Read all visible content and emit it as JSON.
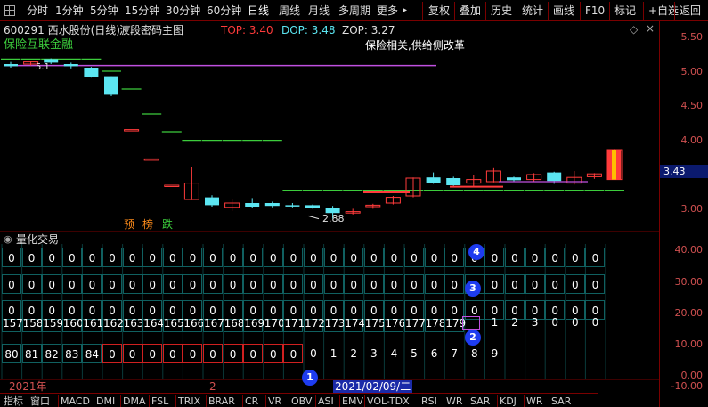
{
  "toolbar": {
    "items": [
      {
        "label": "分时",
        "name": "tab-minute"
      },
      {
        "label": "1分钟",
        "name": "tab-1min"
      },
      {
        "label": "5分钟",
        "name": "tab-5min"
      },
      {
        "label": "15分钟",
        "name": "tab-15min"
      },
      {
        "label": "30分钟",
        "name": "tab-30min"
      },
      {
        "label": "60分钟",
        "name": "tab-60min"
      },
      {
        "label": "日线",
        "name": "tab-daily"
      },
      {
        "label": "周线",
        "name": "tab-weekly"
      },
      {
        "label": "月线",
        "name": "tab-monthly"
      },
      {
        "label": "多周期",
        "name": "tab-multi-period"
      },
      {
        "label": "更多",
        "name": "more-dropdown"
      }
    ],
    "more_arrow": "▸",
    "right_items": [
      {
        "label": "复权",
        "name": "adjust-button"
      },
      {
        "label": "叠加",
        "name": "overlay-button"
      },
      {
        "label": "历史",
        "name": "history-button"
      },
      {
        "label": "统计",
        "name": "stats-button"
      },
      {
        "label": "画线",
        "name": "draw-line-button"
      },
      {
        "label": "F10",
        "name": "f10-button"
      },
      {
        "label": "标记",
        "name": "mark-button"
      },
      {
        "label": "+自选",
        "name": "add-watchlist-button"
      },
      {
        "label": "返回",
        "name": "back-button"
      }
    ]
  },
  "header": {
    "stock": "600291 西水股份(日线)",
    "indicator": "波段密码主图",
    "top_label": "TOP: 3.40",
    "dop_label": "DOP: 3.48",
    "zop_label": "ZOP: 3.27"
  },
  "overlays": {
    "sector": "保险互联金融",
    "note": "保险相关,供给侧改革",
    "price_low": "2.88",
    "tags": [
      "预",
      "榜",
      "跌"
    ],
    "current_price": "3.43",
    "small_label": "5.1"
  },
  "colors": {
    "up": "#ff3b3b",
    "down": "#5ce6f2",
    "green_line": "#3ccc3c",
    "purple_line": "#c050e0",
    "axis_text": "#d05050",
    "grid_border": "#106060",
    "red_border": "#d02020",
    "badge": "#1e3cf0",
    "toolbar_border": "#7a0000"
  },
  "sub_panel": {
    "title": "量化交易",
    "rows": [
      [
        "0",
        "0",
        "0",
        "0",
        "0",
        "0",
        "0",
        "0",
        "0",
        "0",
        "0",
        "0",
        "0",
        "0",
        "0",
        "0",
        "0",
        "0",
        "0",
        "0",
        "0",
        "0",
        "0",
        "0",
        "0",
        "0",
        "0",
        "0",
        "0",
        "0"
      ],
      [
        "0",
        "0",
        "0",
        "0",
        "0",
        "0",
        "0",
        "0",
        "0",
        "0",
        "0",
        "0",
        "0",
        "0",
        "0",
        "0",
        "0",
        "0",
        "0",
        "0",
        "0",
        "0",
        "0",
        "0",
        "0",
        "0",
        "0",
        "0",
        "0",
        "0"
      ],
      [
        "0",
        "0",
        "0",
        "0",
        "0",
        "0",
        "0",
        "0",
        "0",
        "0",
        "0",
        "0",
        "0",
        "0",
        "0",
        "0",
        "0",
        "0",
        "0",
        "0",
        "0",
        "0",
        "0",
        "0",
        "0",
        "0",
        "0",
        "0",
        "0",
        "0"
      ],
      [
        "157",
        "158",
        "159",
        "160",
        "161",
        "162",
        "163",
        "164",
        "165",
        "166",
        "167",
        "168",
        "169",
        "170",
        "171",
        "172",
        "173",
        "174",
        "175",
        "176",
        "177",
        "178",
        "179",
        "",
        "1",
        "2",
        "3",
        "0",
        "0",
        "0"
      ],
      [
        "80",
        "81",
        "82",
        "83",
        "84",
        "0",
        "0",
        "0",
        "0",
        "0",
        "0",
        "0",
        "0",
        "0",
        "0",
        "0",
        "1",
        "2",
        "3",
        "4",
        "5",
        "6",
        "7",
        "8",
        "9",
        "",
        "",
        "",
        "",
        ""
      ]
    ],
    "badges": [
      "1",
      "2",
      "3",
      "4"
    ]
  },
  "axis": {
    "price_ticks": [
      "5.50",
      "5.00",
      "4.50",
      "4.00",
      "3.50",
      "3.00"
    ],
    "sub_ticks": [
      "40.00",
      "30.00",
      "20.00",
      "10.00",
      "0.00",
      "-10.00"
    ]
  },
  "time_bar": {
    "year": "2021年",
    "mid_mark": "2",
    "cursor_date": "2021/02/09/二"
  },
  "bottom_tabs": [
    "指标",
    "窗口",
    "MACD",
    "DMI",
    "DMA",
    "FSL",
    "TRIX",
    "BRAR",
    "CR",
    "VR",
    "OBV",
    "ASI",
    "EMV",
    "VOL-TDX",
    "RSI",
    "WR",
    "SAR",
    "KDJ",
    "WR",
    "SAR"
  ],
  "chart_data": {
    "type": "candlestick",
    "ylim": [
      2.7,
      5.65
    ],
    "candles": [
      {
        "open": 5.05,
        "close": 5.02,
        "high": 5.08,
        "low": 5.0
      },
      {
        "open": 5.05,
        "close": 5.08,
        "high": 5.1,
        "low": 5.03
      },
      {
        "open": 5.12,
        "close": 5.07,
        "high": 5.13,
        "low": 5.05
      },
      {
        "open": 5.05,
        "close": 5.02,
        "high": 5.07,
        "low": 4.99
      },
      {
        "open": 5.0,
        "close": 4.87,
        "high": 5.01,
        "low": 4.86
      },
      {
        "open": 4.88,
        "close": 4.62,
        "high": 4.88,
        "low": 4.6
      },
      {
        "open": 4.13,
        "close": 4.13,
        "high": 4.13,
        "low": 4.13
      },
      {
        "open": 3.72,
        "close": 3.72,
        "high": 3.72,
        "low": 3.72
      },
      {
        "open": 3.35,
        "close": 3.35,
        "high": 3.35,
        "low": 3.35
      },
      {
        "open": 3.15,
        "close": 3.38,
        "high": 3.6,
        "low": 3.14
      },
      {
        "open": 3.18,
        "close": 3.07,
        "high": 3.21,
        "low": 3.05
      },
      {
        "open": 3.04,
        "close": 3.1,
        "high": 3.16,
        "low": 2.99
      },
      {
        "open": 3.1,
        "close": 3.05,
        "high": 3.17,
        "low": 3.03
      },
      {
        "open": 3.1,
        "close": 3.06,
        "high": 3.12,
        "low": 3.04
      },
      {
        "open": 3.07,
        "close": 3.06,
        "high": 3.1,
        "low": 3.04
      },
      {
        "open": 3.07,
        "close": 3.03,
        "high": 3.08,
        "low": 3.02
      },
      {
        "open": 3.03,
        "close": 2.96,
        "high": 3.06,
        "low": 2.88
      },
      {
        "open": 2.96,
        "close": 2.98,
        "high": 3.02,
        "low": 2.94
      },
      {
        "open": 3.05,
        "close": 3.07,
        "high": 3.09,
        "low": 3.02
      },
      {
        "open": 3.1,
        "close": 3.18,
        "high": 3.2,
        "low": 3.08
      },
      {
        "open": 3.2,
        "close": 3.45,
        "high": 3.46,
        "low": 3.18
      },
      {
        "open": 3.46,
        "close": 3.38,
        "high": 3.53,
        "low": 3.37
      },
      {
        "open": 3.45,
        "close": 3.35,
        "high": 3.47,
        "low": 3.34
      },
      {
        "open": 3.38,
        "close": 3.43,
        "high": 3.5,
        "low": 3.33
      },
      {
        "open": 3.4,
        "close": 3.55,
        "high": 3.59,
        "low": 3.39
      },
      {
        "open": 3.46,
        "close": 3.42,
        "high": 3.47,
        "low": 3.4
      },
      {
        "open": 3.43,
        "close": 3.5,
        "high": 3.52,
        "low": 3.4
      },
      {
        "open": 3.53,
        "close": 3.41,
        "high": 3.54,
        "low": 3.37
      },
      {
        "open": 3.38,
        "close": 3.46,
        "high": 3.55,
        "low": 3.36
      },
      {
        "open": 3.47,
        "close": 3.51,
        "high": 3.52,
        "low": 3.44
      },
      {
        "open": 3.43,
        "close": 3.85,
        "high": 3.86,
        "low": 3.43
      }
    ],
    "green_steps": [
      5.12,
      5.12,
      5.12,
      5.12,
      5.12,
      4.95,
      4.7,
      4.35,
      4.1,
      3.98,
      3.98,
      3.98,
      3.98,
      3.98,
      3.28,
      3.28,
      3.28,
      3.28,
      3.28,
      3.28,
      3.28,
      3.28,
      3.28,
      3.28,
      3.28,
      3.28,
      3.28,
      3.28,
      3.28,
      3.28,
      3.28
    ],
    "purple_line": 5.03
  }
}
